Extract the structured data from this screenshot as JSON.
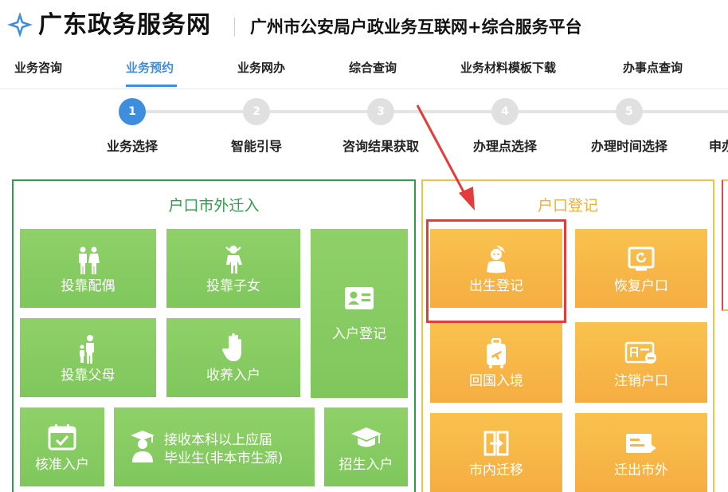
{
  "header": {
    "site_name": "广东政务服务网",
    "platform_name": "广州市公安局户政业务互联网+综合服务平台"
  },
  "nav": {
    "items": [
      {
        "label": "业务咨询",
        "active": false
      },
      {
        "label": "业务预约",
        "active": true
      },
      {
        "label": "业务网办",
        "active": false
      },
      {
        "label": "综合查询",
        "active": false
      },
      {
        "label": "业务材料模板下载",
        "active": false
      },
      {
        "label": "办事点查询",
        "active": false
      }
    ]
  },
  "stepper": {
    "steps": [
      {
        "number": "1",
        "label": "业务选择",
        "active": true
      },
      {
        "number": "2",
        "label": "智能引导",
        "active": false
      },
      {
        "number": "3",
        "label": "咨询结果获取",
        "active": false
      },
      {
        "number": "4",
        "label": "办理点选择",
        "active": false
      },
      {
        "number": "5",
        "label": "办理时间选择",
        "active": false
      },
      {
        "number": "",
        "label": "申办",
        "active": false
      }
    ]
  },
  "panels": {
    "move_in": {
      "title": "户口市外迁入",
      "tiles": {
        "spouse": {
          "label": "投靠配偶",
          "icon": "couple-icon"
        },
        "children": {
          "label": "投靠子女",
          "icon": "child-icon"
        },
        "registration": {
          "label": "入户登记",
          "icon": "id-card-icon"
        },
        "parents": {
          "label": "投靠父母",
          "icon": "parent-child-icon"
        },
        "adoption": {
          "label": "收养入户",
          "icon": "hand-icon"
        },
        "approved": {
          "label": "核准入户",
          "icon": "calendar-check-icon"
        },
        "graduate": {
          "label_1": "接收本科以上应届",
          "label_2": "毕业生(非本市生源)",
          "icon": "graduate-icon"
        },
        "enrollment": {
          "label": "招生入户",
          "icon": "mortarboard-icon"
        }
      }
    },
    "registration": {
      "title": "户口登记",
      "tiles": {
        "birth": {
          "label": "出生登记",
          "icon": "baby-icon"
        },
        "restore": {
          "label": "恢复户口",
          "icon": "restore-icon"
        },
        "return": {
          "label": "回国入境",
          "icon": "luggage-icon"
        },
        "cancel": {
          "label": "注销户口",
          "icon": "cancel-account-icon"
        },
        "local_move": {
          "label": "市内迁移",
          "icon": "transfer-icon"
        },
        "move_out": {
          "label": "迁出市外",
          "icon": "move-out-icon"
        }
      }
    }
  },
  "colors": {
    "accent": "#3e8ede",
    "green_border": "#2e9e4b",
    "green_tile": "#86cc62",
    "yellow_border": "#f0c24a",
    "orange_tile": "#f7b648",
    "highlight": "#e23c3c"
  }
}
